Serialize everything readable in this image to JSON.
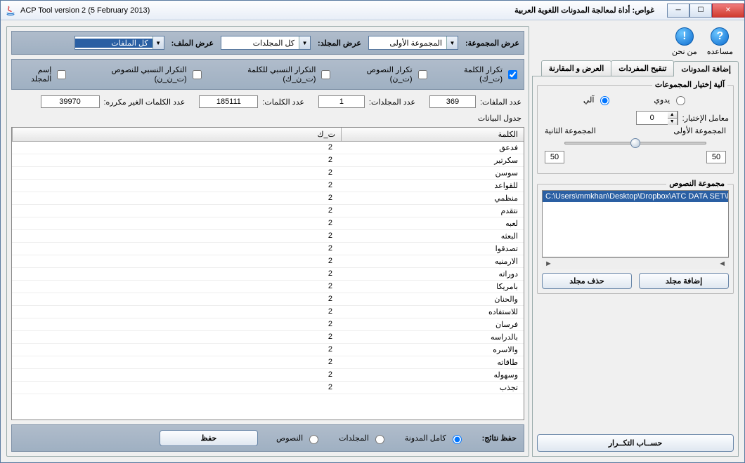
{
  "window": {
    "title_en": "ACP Tool version 2 (5 February 2013)",
    "title_ar": "غواص: أداة لمعالجة المدونات اللغوية العربية"
  },
  "help": {
    "help_label": "مساعده",
    "about_label": "من نحن"
  },
  "tabs": {
    "add_corpus": "إضافة المدونات",
    "refine_vocab": "تنقيح المفردات",
    "view_compare": "العرض و المقارنة"
  },
  "group_select": {
    "legend": "آلية إختيار المجموعات",
    "manual": "يدوي",
    "auto": "آلي",
    "factor_label": "معامل الإختيار:",
    "factor_value": "0",
    "group1_label": "المجموعة الأولى",
    "group2_label": "المجموعة الثانية",
    "slider_left": "50",
    "slider_right": "50"
  },
  "texts_group": {
    "legend": "مجموعة النصوص",
    "path_row": "C:\\Users\\mmkhan\\Desktop\\Dropbox\\ATC DATA SET\\N",
    "add_folder": "إضافة مجلد",
    "delete_folder": "حذف مجلد"
  },
  "compute_btn": "حســاب التكــرار",
  "combos": {
    "group_label": "عرض المجموعة:",
    "group_value": "المجموعة الأولى",
    "folder_label": "عرض المجلد:",
    "folder_value": "كل المجلدات",
    "file_label": "عرض الملف:",
    "file_value": "كل الملفات"
  },
  "checks": {
    "word_freq": "تكرار الكلمة (ت_ك)",
    "doc_freq": "تكرار النصوص (ت_ن)",
    "rel_word_freq": "التكرار النسبي للكلمة (ت_ن_ك)",
    "rel_doc_freq": "التكرار النسبي للنصوص (ت_ن_ن)",
    "folder_name": "إسم المجلد"
  },
  "stats": {
    "files_label": "عدد الملفات:",
    "files_value": "369",
    "folders_label": "عدد المجلدات:",
    "folders_value": "1",
    "words_label": "عدد الكلمات:",
    "words_value": "185111",
    "unique_label": "عدد الكلمات الغير مكرره:",
    "unique_value": "39970"
  },
  "table": {
    "caption": "جدول البيانات",
    "col_word": "الكلمة",
    "col_freq": "ت_ك",
    "rows": [
      {
        "w": "فدعق",
        "f": "2"
      },
      {
        "w": "سكرتير",
        "f": "2"
      },
      {
        "w": "سوسن",
        "f": "2"
      },
      {
        "w": "للقواعد",
        "f": "2"
      },
      {
        "w": "منظمي",
        "f": "2"
      },
      {
        "w": "نتقدم",
        "f": "2"
      },
      {
        "w": "لعبه",
        "f": "2"
      },
      {
        "w": "البعثه",
        "f": "2"
      },
      {
        "w": "تصدقوا",
        "f": "2"
      },
      {
        "w": "الارمنيه",
        "f": "2"
      },
      {
        "w": "دوراته",
        "f": "2"
      },
      {
        "w": "بامريكا",
        "f": "2"
      },
      {
        "w": "والحنان",
        "f": "2"
      },
      {
        "w": "للاستفاده",
        "f": "2"
      },
      {
        "w": "فرسان",
        "f": "2"
      },
      {
        "w": "بالدراسه",
        "f": "2"
      },
      {
        "w": "والاسره",
        "f": "2"
      },
      {
        "w": "طاقاته",
        "f": "2"
      },
      {
        "w": "وسهوله",
        "f": "2"
      },
      {
        "w": "تجذب",
        "f": "2"
      }
    ]
  },
  "save_row": {
    "label": "حفظ نتائج:",
    "whole": "كامل المدونة",
    "folders": "المجلدات",
    "texts": "النصوص",
    "save": "حفظ"
  }
}
